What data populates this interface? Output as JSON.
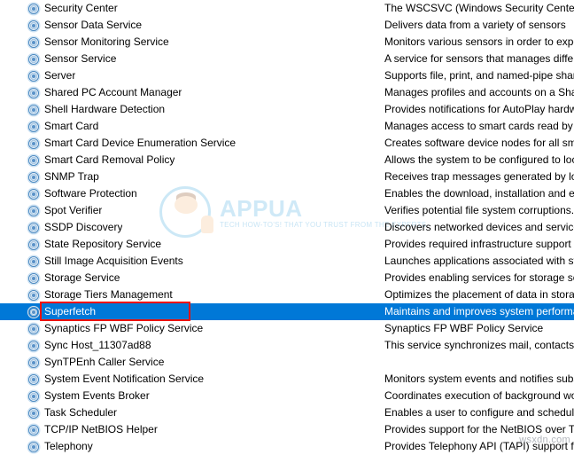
{
  "watermark": {
    "brand": "APPUA",
    "tagline": "TECH HOW-TO'S! THAT YOU TRUST FROM THE EXPERTS"
  },
  "footer_watermark": "wsxdn.com",
  "selected": "Superfetch",
  "highlight_box": "Superfetch",
  "services": [
    {
      "name": "Security Center",
      "desc": "The WSCSVC (Windows Security Center) servic"
    },
    {
      "name": "Sensor Data Service",
      "desc": "Delivers data from a variety of sensors"
    },
    {
      "name": "Sensor Monitoring Service",
      "desc": "Monitors various sensors in order to expose da"
    },
    {
      "name": "Sensor Service",
      "desc": "A service for sensors that manages different se"
    },
    {
      "name": "Server",
      "desc": "Supports file, print, and named-pipe sharing o"
    },
    {
      "name": "Shared PC Account Manager",
      "desc": "Manages profiles and accounts on a SharedPC"
    },
    {
      "name": "Shell Hardware Detection",
      "desc": "Provides notifications for AutoPlay hardware e"
    },
    {
      "name": "Smart Card",
      "desc": "Manages access to smart cards read by this co"
    },
    {
      "name": "Smart Card Device Enumeration Service",
      "desc": "Creates software device nodes for all smart ca"
    },
    {
      "name": "Smart Card Removal Policy",
      "desc": "Allows the system to be configured to lock the"
    },
    {
      "name": "SNMP Trap",
      "desc": "Receives trap messages generated by local or"
    },
    {
      "name": "Software Protection",
      "desc": "Enables the download, installation and enforc"
    },
    {
      "name": "Spot Verifier",
      "desc": "Verifies potential file system corruptions."
    },
    {
      "name": "SSDP Discovery",
      "desc": "Discovers networked devices and services that"
    },
    {
      "name": "State Repository Service",
      "desc": "Provides required infrastructure support for th"
    },
    {
      "name": "Still Image Acquisition Events",
      "desc": "Launches applications associated with still im"
    },
    {
      "name": "Storage Service",
      "desc": "Provides enabling services for storage settings"
    },
    {
      "name": "Storage Tiers Management",
      "desc": "Optimizes the placement of data in storage tie"
    },
    {
      "name": "Superfetch",
      "desc": "Maintains and improves system performance o"
    },
    {
      "name": "Synaptics FP WBF Policy Service",
      "desc": "Synaptics FP WBF Policy Service"
    },
    {
      "name": "Sync Host_11307ad88",
      "desc": "This service synchronizes mail, contacts, calen"
    },
    {
      "name": "SynTPEnh Caller Service",
      "desc": ""
    },
    {
      "name": "System Event Notification Service",
      "desc": "Monitors system events and notifies subscribe"
    },
    {
      "name": "System Events Broker",
      "desc": "Coordinates execution of background work fo"
    },
    {
      "name": "Task Scheduler",
      "desc": "Enables a user to configure and schedule auto"
    },
    {
      "name": "TCP/IP NetBIOS Helper",
      "desc": "Provides support for the NetBIOS over TCP/IP"
    },
    {
      "name": "Telephony",
      "desc": "Provides Telephony API (TAPI) support for pro"
    }
  ]
}
